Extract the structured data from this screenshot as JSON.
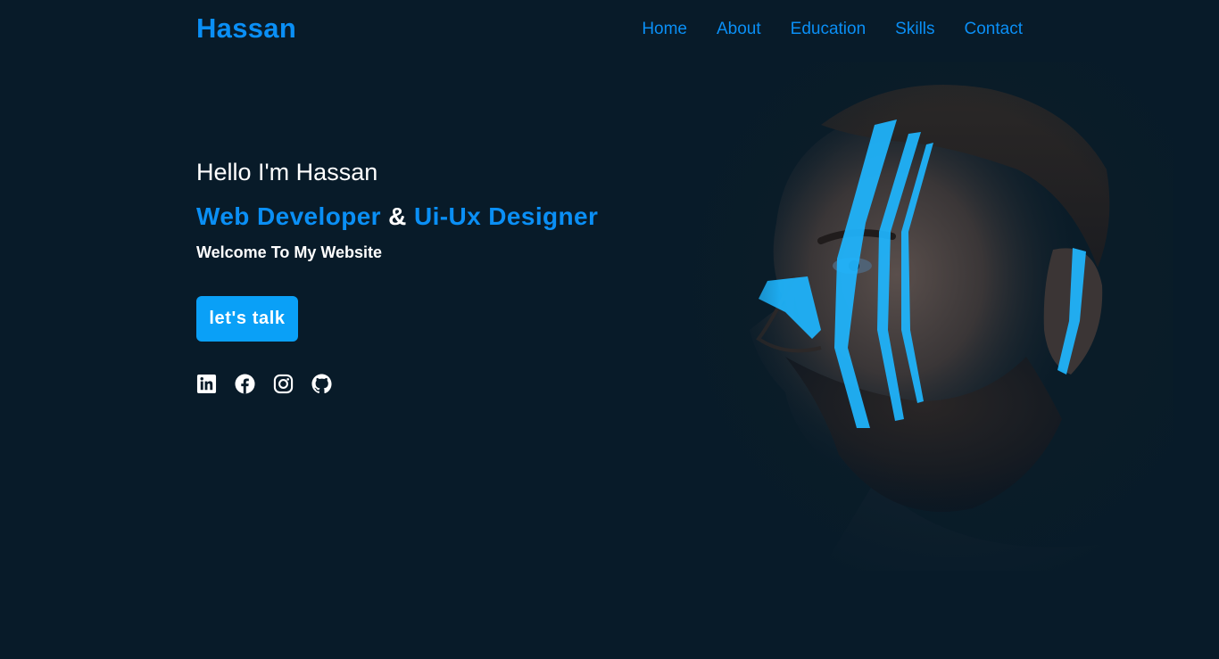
{
  "header": {
    "logo": "Hassan",
    "nav": [
      {
        "label": "Home"
      },
      {
        "label": "About"
      },
      {
        "label": "Education"
      },
      {
        "label": "Skills"
      },
      {
        "label": "Contact"
      }
    ]
  },
  "hero": {
    "greeting": "Hello I'm Hassan",
    "role_primary": "Web Developer",
    "role_joiner": "&",
    "role_secondary": "Ui-Ux Designer",
    "welcome": "Welcome To My Website",
    "cta_label": "let's talk",
    "socials": [
      {
        "icon": "linkedin-icon"
      },
      {
        "icon": "facebook-icon"
      },
      {
        "icon": "instagram-icon"
      },
      {
        "icon": "github-icon"
      }
    ]
  },
  "colors": {
    "background": "#081b29",
    "accent": "#0a8ff5",
    "button": "#0aa0f7",
    "text": "#ffffff",
    "face_paint": "#1fb6ff"
  }
}
